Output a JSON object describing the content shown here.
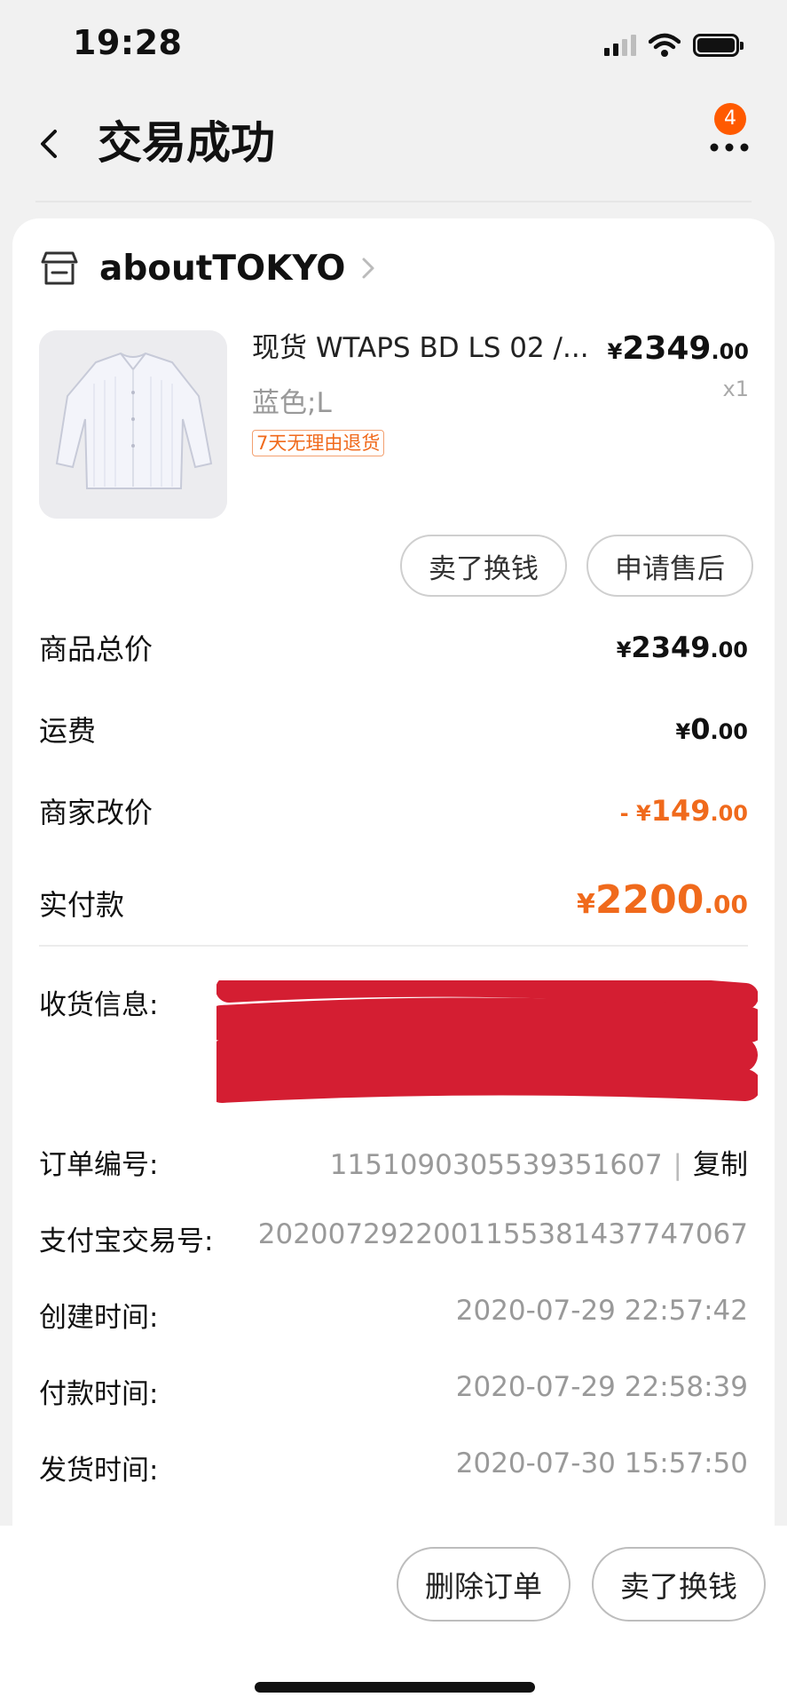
{
  "status_bar": {
    "time": "19:28"
  },
  "header": {
    "title": "交易成功",
    "notification_count": "4"
  },
  "shop": {
    "name": "aboutTOKYO"
  },
  "product": {
    "title": "现货 WTAPS BD LS 02 /...",
    "variant": "蓝色;L",
    "tag": "7天无理由退货",
    "price_symbol": "¥",
    "price_int": "2349",
    "price_dec": ".00",
    "quantity": "x1"
  },
  "actions": {
    "sell": "卖了换钱",
    "after_sales": "申请售后"
  },
  "fees": [
    {
      "label": "商品总价",
      "prefix": "¥",
      "int": "2349",
      "dec": ".00"
    },
    {
      "label": "运费",
      "prefix": "¥",
      "int": "0",
      "dec": ".00"
    },
    {
      "label": "商家改价",
      "prefix": "- ¥",
      "int": "149",
      "dec": ".00"
    },
    {
      "label": "实付款",
      "prefix": "¥",
      "int": "2200",
      "dec": ".00"
    }
  ],
  "order_info": {
    "shipping_label": "收货信息:",
    "order_no_label": "订单编号:",
    "order_no": "1151090305539351607",
    "order_no_sep": "|",
    "copy_label": "复制",
    "alipay_label": "支付宝交易号:",
    "alipay_no": "2020072922001155381437747067",
    "created_label": "创建时间:",
    "created": "2020-07-29 22:57:42",
    "paid_label": "付款时间:",
    "paid": "2020-07-29 22:58:39",
    "shipped_label": "发货时间:",
    "shipped": "2020-07-30 15:57:50"
  },
  "bottom_actions": {
    "delete": "删除订单",
    "sell": "卖了换钱"
  },
  "colors": {
    "accent": "#f06a1c",
    "badge": "#ff5a00",
    "redaction": "#d41e32"
  }
}
